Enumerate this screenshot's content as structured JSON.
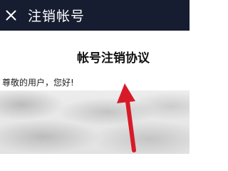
{
  "header": {
    "close_icon": "close-icon",
    "title": "注销帐号"
  },
  "document": {
    "title": "帐号注销协议",
    "greeting": "尊敬的用户，您好!"
  },
  "colors": {
    "header_bg": "#171d30",
    "header_text": "#ffffff",
    "annotation_arrow": "#d81a28"
  }
}
